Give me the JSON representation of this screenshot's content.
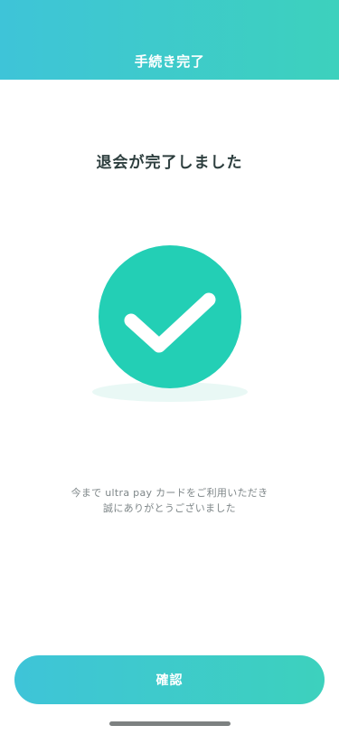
{
  "header": {
    "title": "手続き完了"
  },
  "main": {
    "heading": "退会が完了しました",
    "illustration_icon": "check-circle-icon",
    "message_line1": "今まで ultra pay カードをご利用いただき",
    "message_line2": "誠にありがとうございました"
  },
  "footer": {
    "confirm_label": "確認"
  },
  "colors": {
    "accent_start": "#3ec4d8",
    "accent_end": "#3dd1bd",
    "check_circle": "#23cfb5",
    "heading_text": "#2e3f3f",
    "body_text": "#7e8688"
  }
}
